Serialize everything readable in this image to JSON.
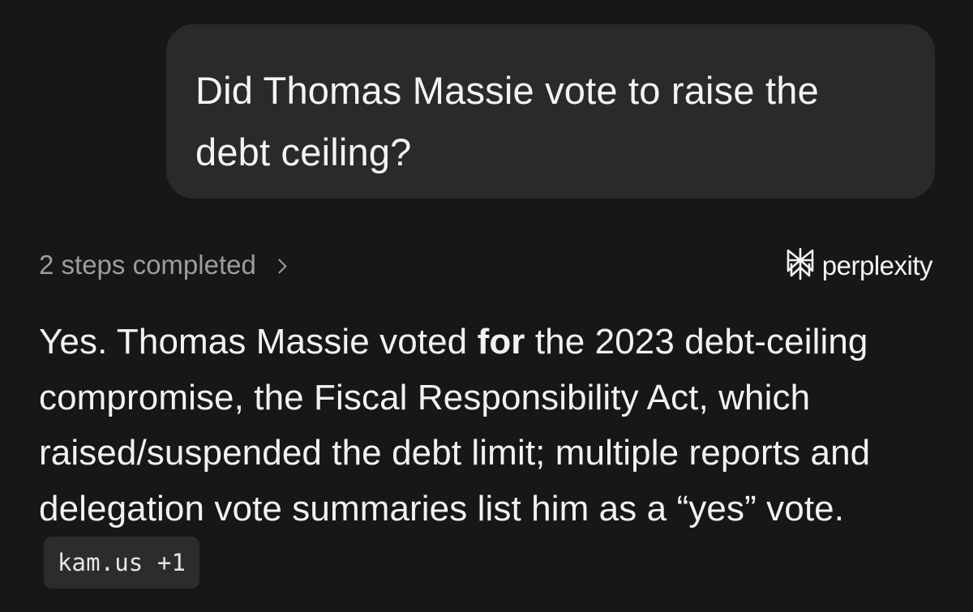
{
  "user_message": {
    "text": "Did Thomas Massie vote to raise the debt ceiling?"
  },
  "meta": {
    "steps_label": "2 steps completed",
    "brand_name": "perplexity",
    "brand_icon": "perplexity-logo-icon"
  },
  "answer": {
    "part1": "Yes. Thomas Massie voted ",
    "bold": "for",
    "part2": " the 2023 debt-ceiling compromise, the Fiscal Responsibility Act, which raised/suspended the debt limit; multiple reports and delegation vote summaries list him as a “yes” vote.",
    "citation": "kam.us +1"
  },
  "colors": {
    "background": "#171717",
    "bubble": "#2a2a2a",
    "muted_text": "#9d9d9d",
    "citation_bg": "#2c2c2c"
  }
}
